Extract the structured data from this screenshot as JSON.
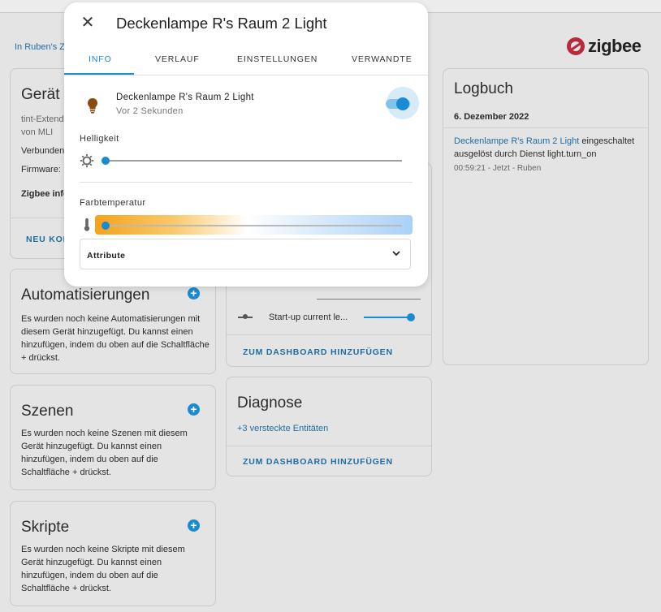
{
  "breadcrumb": "In Ruben's Z",
  "brand": "zigbee",
  "device_card": {
    "title": "Gerät I",
    "line1": "tint-Extend",
    "line2": "von MLI",
    "connected": "Verbunden",
    "firmware": "Firmware:",
    "zigbee_info": "Zigbee info",
    "action": "NEU KON"
  },
  "automations": {
    "title": "Automatisierungen",
    "text": "Es wurden noch keine Automatisierungen mit diesem Gerät hinzugefügt. Du kannst einen hinzufügen, indem du oben auf die Schaltfläche + drückst."
  },
  "scenes": {
    "title": "Szenen",
    "text": "Es wurden noch keine Szenen mit diesem Gerät hinzugefügt. Du kannst einen hinzufügen, indem du oben auf die Schaltfläche + drückst."
  },
  "scripts": {
    "title": "Skripte",
    "text": "Es wurden noch keine Skripte mit diesem Gerät hinzugefügt. Du kannst einen hinzufügen, indem du oben auf die Schaltfläche + drückst."
  },
  "config_card": {
    "row_label": "Start-up current le...",
    "action": "ZUM DASHBOARD HINZUFÜGEN"
  },
  "diagnose": {
    "title": "Diagnose",
    "hidden": "+3 versteckte Entitäten",
    "action": "ZUM DASHBOARD HINZUFÜGEN"
  },
  "logbook": {
    "title": "Logbuch",
    "date": "6. Dezember 2022",
    "entity_link": "Deckenlampe R's Raum 2 Light",
    "event_suffix": " eingeschaltet",
    "event_line2": "ausgelöst durch Dienst light.turn_on",
    "meta": "00:59:21 - Jetzt - Ruben"
  },
  "dialog": {
    "title": "Deckenlampe R's Raum 2 Light",
    "tabs": [
      "INFO",
      "VERLAUF",
      "EINSTELLUNGEN",
      "VERWANDTE"
    ],
    "active_tab": "INFO",
    "entity_name": "Deckenlampe R's Raum 2 Light",
    "last_changed": "Vor 2 Sekunden",
    "state_on": true,
    "brightness_label": "Helligkeit",
    "brightness_fraction": 0.0,
    "color_temp_label": "Farbtemperatur",
    "color_temp_fraction": 0.0,
    "attributes_label": "Attribute"
  },
  "colors": {
    "accent": "#1a8ad3",
    "brand_red": "#b8293b",
    "bulb_on": "#8a4a10"
  }
}
